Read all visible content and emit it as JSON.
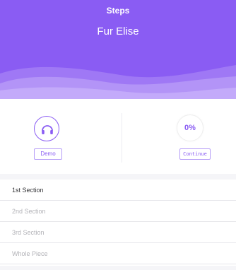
{
  "header": {
    "title": "Steps",
    "song": "Fur Elise"
  },
  "demo": {
    "label": "Demo",
    "icon": "headphones-icon"
  },
  "progress": {
    "value": "0%",
    "continue_label": "Continue"
  },
  "sections": [
    {
      "label": "1st Section",
      "active": true
    },
    {
      "label": "2nd Section",
      "active": false
    },
    {
      "label": "3rd Section",
      "active": false
    },
    {
      "label": "Whole Piece",
      "active": false
    }
  ],
  "colors": {
    "accent": "#8a5cf3",
    "active_text": "#333336",
    "inactive_text": "#b3b3b8"
  }
}
